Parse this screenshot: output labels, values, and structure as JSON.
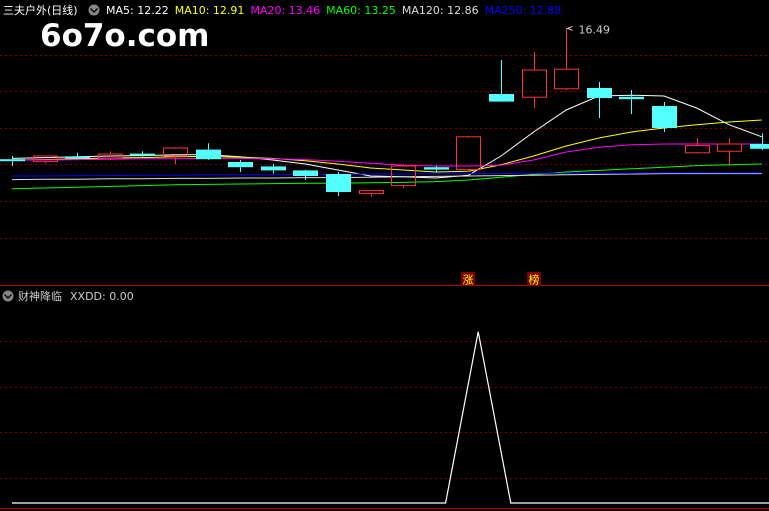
{
  "header": {
    "stock_name": "三夫户外(日线)",
    "ma_items": [
      {
        "label": "MA5: 12.22",
        "color": "#ffffff"
      },
      {
        "label": "MA10: 12.91",
        "color": "#ffff00"
      },
      {
        "label": "MA20: 13.46",
        "color": "#ff00ff"
      },
      {
        "label": "MA60: 13.25",
        "color": "#00ff00"
      },
      {
        "label": "MA120: 12.86",
        "color": "#dddddd"
      },
      {
        "label": "MA250: 12.88",
        "color": "#0000ff"
      }
    ]
  },
  "watermark": "6o7o.com",
  "indicator": {
    "name": "财神降临",
    "value_label": "XXDD: 0.00"
  },
  "colors": {
    "up": "#ff3232",
    "down": "#54ffff",
    "grid": "#800000",
    "axis": "#c00000",
    "marker_bg": "#800000",
    "marker_text": "#ffff00"
  },
  "chart_data": [
    {
      "type": "candlestick",
      "ylim": [
        11.3,
        16.7
      ],
      "peak_annotation": "16.49",
      "candles": [
        {
          "o": 13.2,
          "h": 13.3,
          "l": 13.05,
          "c": 13.22,
          "dir": "down"
        },
        {
          "o": 13.16,
          "h": 13.32,
          "l": 13.12,
          "c": 13.3,
          "dir": "up"
        },
        {
          "o": 13.29,
          "h": 13.38,
          "l": 13.22,
          "c": 13.27,
          "dir": "down"
        },
        {
          "o": 13.25,
          "h": 13.42,
          "l": 13.2,
          "c": 13.35,
          "dir": "up"
        },
        {
          "o": 13.36,
          "h": 13.42,
          "l": 13.28,
          "c": 13.32,
          "dir": "down"
        },
        {
          "o": 13.3,
          "h": 13.52,
          "l": 13.1,
          "c": 13.5,
          "dir": "up"
        },
        {
          "o": 13.46,
          "h": 13.62,
          "l": 13.2,
          "c": 13.22,
          "dir": "down"
        },
        {
          "o": 13.15,
          "h": 13.2,
          "l": 12.9,
          "c": 13.02,
          "dir": "down"
        },
        {
          "o": 13.04,
          "h": 13.1,
          "l": 12.86,
          "c": 12.94,
          "dir": "down"
        },
        {
          "o": 12.94,
          "h": 12.96,
          "l": 12.7,
          "c": 12.8,
          "dir": "down"
        },
        {
          "o": 12.85,
          "h": 12.9,
          "l": 12.3,
          "c": 12.4,
          "dir": "down"
        },
        {
          "o": 12.36,
          "h": 12.45,
          "l": 12.28,
          "c": 12.44,
          "dir": "up"
        },
        {
          "o": 12.56,
          "h": 13.1,
          "l": 12.5,
          "c": 13.05,
          "dir": "up"
        },
        {
          "o": 13.02,
          "h": 13.06,
          "l": 12.9,
          "c": 12.96,
          "dir": "down"
        },
        {
          "o": 12.96,
          "h": 13.8,
          "l": 12.9,
          "c": 13.78,
          "dir": "up"
        },
        {
          "o": 14.85,
          "h": 15.7,
          "l": 14.72,
          "c": 14.66,
          "dir": "down"
        },
        {
          "o": 14.77,
          "h": 15.9,
          "l": 14.5,
          "c": 15.45,
          "dir": "up"
        },
        {
          "o": 14.98,
          "h": 16.49,
          "l": 14.95,
          "c": 15.47,
          "dir": "up"
        },
        {
          "o": 15.0,
          "h": 15.15,
          "l": 14.25,
          "c": 14.75,
          "dir": "down"
        },
        {
          "o": 14.78,
          "h": 14.95,
          "l": 14.35,
          "c": 14.72,
          "dir": "down"
        },
        {
          "o": 14.55,
          "h": 14.65,
          "l": 13.9,
          "c": 14.0,
          "dir": "down"
        },
        {
          "o": 13.56,
          "h": 13.75,
          "l": 13.4,
          "c": 13.38,
          "dir": "up"
        },
        {
          "o": 13.42,
          "h": 13.75,
          "l": 13.05,
          "c": 13.6,
          "dir": "up"
        },
        {
          "o": 13.6,
          "h": 13.87,
          "l": 13.45,
          "c": 13.48,
          "dir": "down"
        }
      ],
      "ma_lines": [
        {
          "name": "MA5",
          "color": "#ffffff",
          "values": [
            13.24,
            13.26,
            13.28,
            13.3,
            13.31,
            13.33,
            13.33,
            13.28,
            13.2,
            13.1,
            12.95,
            12.8,
            12.78,
            12.75,
            12.82,
            13.3,
            13.9,
            14.45,
            14.8,
            14.82,
            14.8,
            14.5,
            14.08,
            13.78
          ]
        },
        {
          "name": "MA10",
          "color": "#ffff00",
          "values": [
            13.2,
            13.21,
            13.23,
            13.25,
            13.26,
            13.28,
            13.29,
            13.27,
            13.24,
            13.18,
            13.1,
            13.0,
            12.95,
            12.9,
            12.92,
            13.08,
            13.3,
            13.55,
            13.75,
            13.9,
            14.0,
            14.08,
            14.15,
            14.2
          ]
        },
        {
          "name": "MA20",
          "color": "#ff00ff",
          "values": [
            13.2,
            13.2,
            13.21,
            13.22,
            13.23,
            13.23,
            13.24,
            13.24,
            13.23,
            13.21,
            13.17,
            13.12,
            13.07,
            13.05,
            13.05,
            13.07,
            13.2,
            13.4,
            13.52,
            13.58,
            13.6,
            13.6,
            13.6,
            13.6
          ]
        },
        {
          "name": "MA60",
          "color": "#00ff00",
          "values": [
            12.48,
            12.5,
            12.52,
            12.54,
            12.56,
            12.58,
            12.59,
            12.6,
            12.61,
            12.62,
            12.62,
            12.63,
            12.64,
            12.66,
            12.7,
            12.77,
            12.84,
            12.9,
            12.94,
            12.98,
            13.02,
            13.06,
            13.08,
            13.1
          ]
        },
        {
          "name": "MA120",
          "color": "#dddddd",
          "values": [
            12.71,
            12.72,
            12.72,
            12.73,
            12.73,
            12.74,
            12.74,
            12.75,
            12.75,
            12.76,
            12.76,
            12.77,
            12.78,
            12.79,
            12.8,
            12.81,
            12.82,
            12.83,
            12.84,
            12.85,
            12.86,
            12.86,
            12.86,
            12.86
          ]
        },
        {
          "name": "MA250",
          "color": "#0000ff",
          "values": [
            12.8,
            12.8,
            12.81,
            12.81,
            12.82,
            12.82,
            12.83,
            12.83,
            12.83,
            12.84,
            12.84,
            12.85,
            12.85,
            12.86,
            12.86,
            12.86,
            12.87,
            12.87,
            12.87,
            12.87,
            12.88,
            12.88,
            12.88,
            12.88
          ]
        }
      ],
      "markers": [
        {
          "candle_index": 14,
          "label": "涨"
        },
        {
          "candle_index": 16,
          "label": "榜"
        }
      ]
    },
    {
      "type": "line",
      "series": [
        {
          "name": "XXDD",
          "color": "#ffffff",
          "points": [
            [
              0,
              0
            ],
            [
              13.3,
              0
            ],
            [
              14.3,
              1
            ],
            [
              15.3,
              0
            ],
            [
              23.5,
              0
            ]
          ]
        }
      ],
      "ylim": [
        0,
        1.15
      ]
    }
  ]
}
